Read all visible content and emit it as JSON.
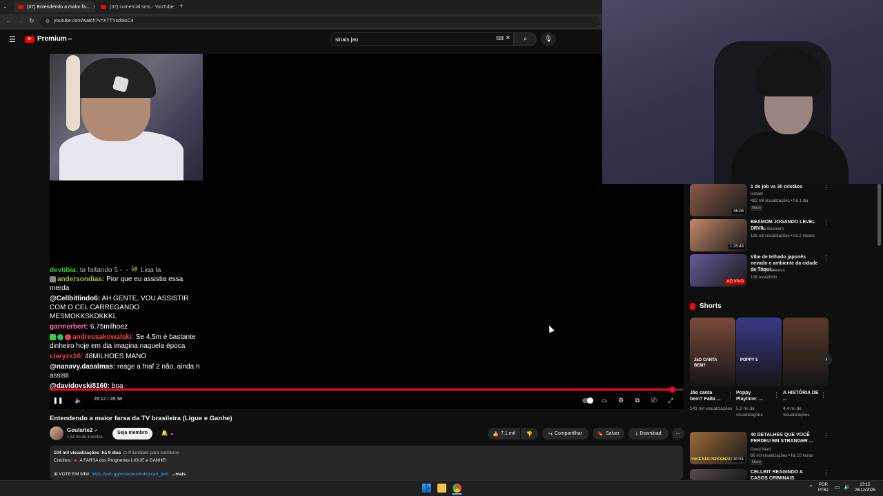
{
  "browser": {
    "tabs": [
      {
        "label": "(37) Entendendo a maior fa..."
      },
      {
        "label": "(37) comercial sms - YouTube"
      }
    ],
    "new_tab": "+",
    "url": "youtube.com/watch?v=XTTYsdI8sC4"
  },
  "header": {
    "brand": "Premium",
    "brand_sup": "BR",
    "search_value": "sinais jao"
  },
  "chat": [
    {
      "user": "devtibia:",
      "text": "ta faltando 5 -_- 🎋 Liga la",
      "color": "#3ccf3c"
    },
    {
      "user": "andersondias:",
      "text": "Pior que eu assistia essa merda",
      "color": "#9acd32"
    },
    {
      "user": "@Cellbitlindo6:",
      "text": "AH GENTE, VOU ASSISTIR COM O CEL CARREGANDO MESMOKKSKDKKKL",
      "color": "#ffffff"
    },
    {
      "user": "garmerbert:",
      "text": "6.75milhoez",
      "color": "#ff69b4"
    },
    {
      "user": "andressakowalski:",
      "text": "Se 4,5m é bastante dinheiro hoje em dia imagina naquela época",
      "color": "#ff4040"
    },
    {
      "user": "claryzx16:",
      "text": "48MILHOES MANO",
      "color": "#ff4040"
    },
    {
      "user": "@nanavy.dasalmas:",
      "text": "reage a fnaf 2 não, ainda n assisti",
      "color": "#ffffff"
    },
    {
      "user": "@davidovski8160:",
      "text": "boa",
      "color": "#ffffff"
    }
  ],
  "player": {
    "time": "26:12 / 26:38",
    "progress": 0.983
  },
  "recommendations": [
    {
      "title": "1 do job vs 30 cristãos",
      "channel": "Ismael",
      "meta": "482 mil visualizações • há 1 dia",
      "badge": "Novo",
      "duration": "46:08",
      "thumb": "#8a5a4a"
    },
    {
      "title": "BEAMOM JOGANDO LEVEL DEVIL",
      "channel": "Lives da Beamom",
      "meta": "126 mil visualizações • há 2 meses",
      "badge": "",
      "duration": "1:25:43",
      "thumb": "#c78a6a"
    },
    {
      "title": "Vibe de telhado japonês nevado e ambiente da cidade de Tóqui...",
      "channel": "Lofi Tokyo Dreams",
      "meta": "138 assistindo",
      "badge": "",
      "duration": "AO VIVO",
      "thumb": "#6a5a9a"
    }
  ],
  "shorts": {
    "heading": "Shorts",
    "items": [
      {
        "title": "Jão canta bem? Falta ...",
        "views": "141 mil visualizações",
        "thumb": "#7a4a3a",
        "overlay": "JãO CANTA BEM?"
      },
      {
        "title": "Poppy Playtime: ...",
        "views": "5,2 mi de visualizações",
        "thumb": "#3a3a8a",
        "overlay": "POPPY 5"
      },
      {
        "title": "A HISTÓRIA DE ...",
        "views": "4,4 mi de visualizações",
        "thumb": "#5a3a2a",
        "overlay": ""
      }
    ]
  },
  "more_recs": [
    {
      "title": "40 DETALHES QUE VOCÊ PERDEU EM STRANGER ...",
      "channel": "Good Nerd",
      "meta": "66 mil visualizações • há 10 horas",
      "badge": "Novo",
      "duration": "30:51",
      "thumb": "#9a6a3a",
      "overlay": "VOCÊ NÃO PERCEBEU ISS"
    },
    {
      "title": "CELLBIT REAGINDO A CASOS CRIMINAIS",
      "channel": "",
      "meta": "",
      "badge": "",
      "duration": "",
      "thumb": "#5a4a4a",
      "overlay": ""
    }
  ],
  "video": {
    "title": "Entendendo a maior farsa da TV brasileira (Ligue e Ganhe)",
    "channel": "Goularte2",
    "subscribers": "1,52 mi de inscritos",
    "join_label": "Seja membro",
    "likes": "7,1 mil",
    "share_label": "Compartilhar",
    "save_label": "Salvar",
    "download_label": "Download",
    "views": "104 mil visualizações",
    "age": "há 9 dias",
    "priority": "Prioridade para membros",
    "credits": "Créditos: 🔺 A FARSA dos Programas LIGUE e GANHE!",
    "vote": "⊞ VOTE EM MIM:",
    "vote_link": "https://peb.gg/votacoes/indicacao_pub",
    "more": "...mais"
  },
  "system": {
    "lang1": "POR",
    "lang2": "PTB2",
    "time": "23:15",
    "date": "28/12/2025"
  }
}
